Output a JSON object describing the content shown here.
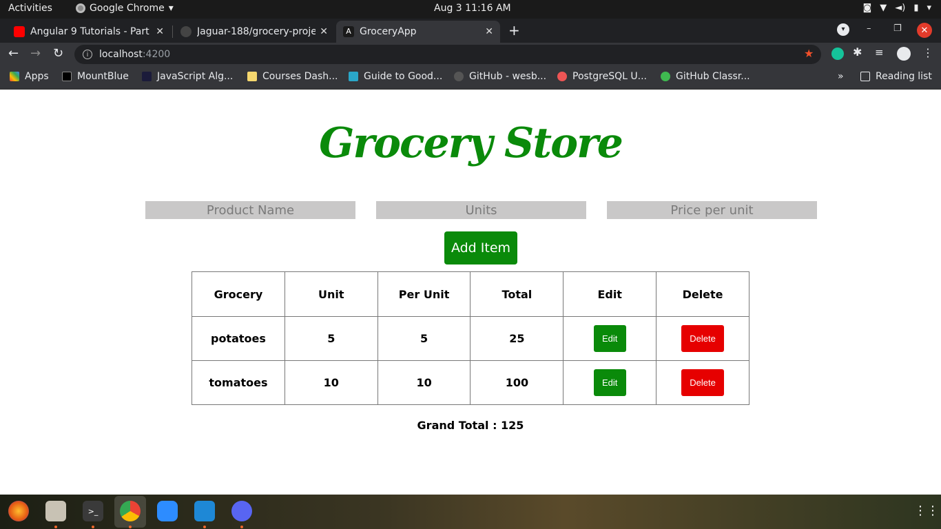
{
  "system": {
    "activities": "Activities",
    "app_name": "Google Chrome",
    "clock": "Aug 3  11:16 AM"
  },
  "tabs": [
    {
      "title": "Angular 9 Tutorials - Part",
      "icon": "youtube-icon"
    },
    {
      "title": "Jaguar-188/grocery-proje",
      "icon": "github-icon"
    },
    {
      "title": "GroceryApp",
      "icon": "angular-icon",
      "active": true
    }
  ],
  "toolbar": {
    "url_host": "localhost",
    "url_port": ":4200"
  },
  "bookmarks": [
    {
      "label": "Apps",
      "icon": "apps-grid-icon"
    },
    {
      "label": "MountBlue",
      "icon": "mountblue-icon"
    },
    {
      "label": "JavaScript Alg...",
      "icon": "js-icon"
    },
    {
      "label": "Courses Dash...",
      "icon": "crown-icon"
    },
    {
      "label": "Guide to Good...",
      "icon": "guide-icon"
    },
    {
      "label": "GitHub - wesb...",
      "icon": "github-icon"
    },
    {
      "label": "PostgreSQL U...",
      "icon": "postgres-icon"
    },
    {
      "label": "GitHub Classr...",
      "icon": "github-icon"
    }
  ],
  "reading_list": "Reading list",
  "page": {
    "title": "Grocery Store",
    "inputs": {
      "product_placeholder": "Product Name",
      "units_placeholder": "Units",
      "price_placeholder": "Price per unit"
    },
    "add_button": "Add Item",
    "table": {
      "headers": [
        "Grocery",
        "Unit",
        "Per Unit",
        "Total",
        "Edit",
        "Delete"
      ],
      "rows": [
        {
          "grocery": "potatoes",
          "unit": "5",
          "per_unit": "5",
          "total": "25",
          "edit": "Edit",
          "delete": "Delete"
        },
        {
          "grocery": "tomatoes",
          "unit": "10",
          "per_unit": "10",
          "total": "100",
          "edit": "Edit",
          "delete": "Delete"
        }
      ]
    },
    "grand_total": "Grand Total : 125"
  },
  "colors": {
    "brand_green": "#0a8a0a",
    "delete_red": "#e60000",
    "input_gray": "#c9c8c8"
  }
}
